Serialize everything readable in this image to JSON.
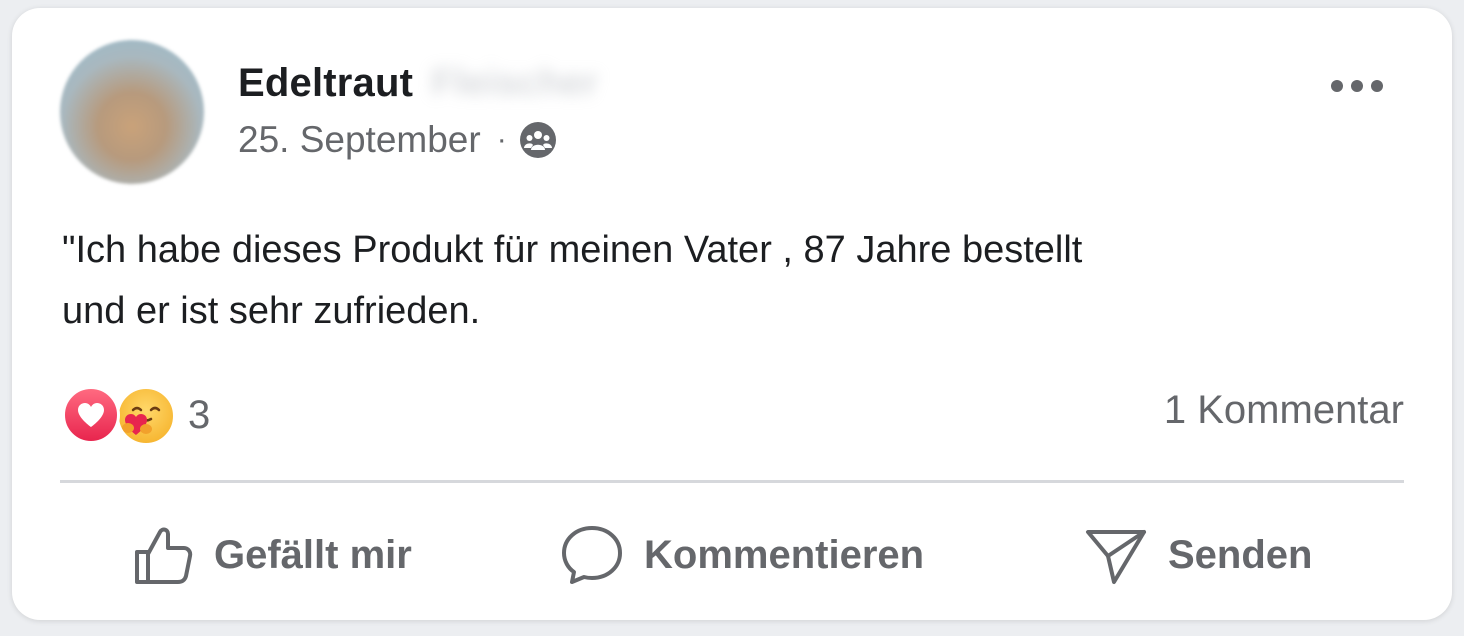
{
  "post": {
    "author_first_name": "Edeltraut",
    "author_last_name_blurred": "Fleischer",
    "date": "25. September",
    "separator": "·",
    "audience_icon": "friends-icon",
    "more_icon": "more-options-icon",
    "text": "\"Ich habe dieses Produkt für meinen Vater , 87 Jahre bestellt\nund er ist sehr zufrieden."
  },
  "engagement": {
    "reaction_icons": [
      "love-reaction-icon",
      "care-reaction-icon"
    ],
    "reaction_count": "3",
    "comment_count": "1 Kommentar"
  },
  "actions": {
    "like_label": "Gefällt mir",
    "comment_label": "Kommentieren",
    "send_label": "Senden"
  },
  "colors": {
    "text_primary": "#1c1e21",
    "text_secondary": "#65676b",
    "divider": "#d6d8dc",
    "love": "#e8254e",
    "care": "#f7b733"
  }
}
